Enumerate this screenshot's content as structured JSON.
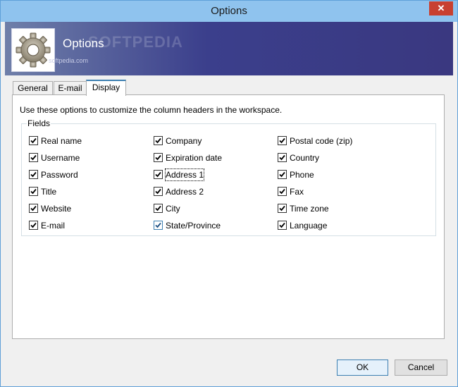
{
  "window": {
    "title": "Options",
    "close_glyph": "✕"
  },
  "banner": {
    "title": "Options",
    "watermark": "softpedia.com",
    "watermark_brand": "SOFTPEDIA",
    "icon": "gear-icon"
  },
  "tabs": [
    {
      "label": "General",
      "active": false
    },
    {
      "label": "E-mail",
      "active": false
    },
    {
      "label": "Display",
      "active": true
    }
  ],
  "display": {
    "description": "Use these options to customize the column headers in the workspace.",
    "fields_legend": "Fields",
    "columns": [
      [
        {
          "label": "Real name",
          "checked": true
        },
        {
          "label": "Username",
          "checked": true
        },
        {
          "label": "Password",
          "checked": true
        },
        {
          "label": "Title",
          "checked": true
        },
        {
          "label": "Website",
          "checked": true
        },
        {
          "label": "E-mail",
          "checked": true
        }
      ],
      [
        {
          "label": "Company",
          "checked": true
        },
        {
          "label": "Expiration date",
          "checked": true
        },
        {
          "label": "Address 1",
          "checked": true,
          "focused": true
        },
        {
          "label": "Address 2",
          "checked": true
        },
        {
          "label": "City",
          "checked": true
        },
        {
          "label": "State/Province",
          "checked": true,
          "hover": true
        }
      ],
      [
        {
          "label": "Postal code (zip)",
          "checked": true
        },
        {
          "label": "Country",
          "checked": true
        },
        {
          "label": "Phone",
          "checked": true
        },
        {
          "label": "Fax",
          "checked": true
        },
        {
          "label": "Time zone",
          "checked": true
        },
        {
          "label": "Language",
          "checked": true
        }
      ]
    ]
  },
  "buttons": {
    "ok": "OK",
    "cancel": "Cancel"
  }
}
